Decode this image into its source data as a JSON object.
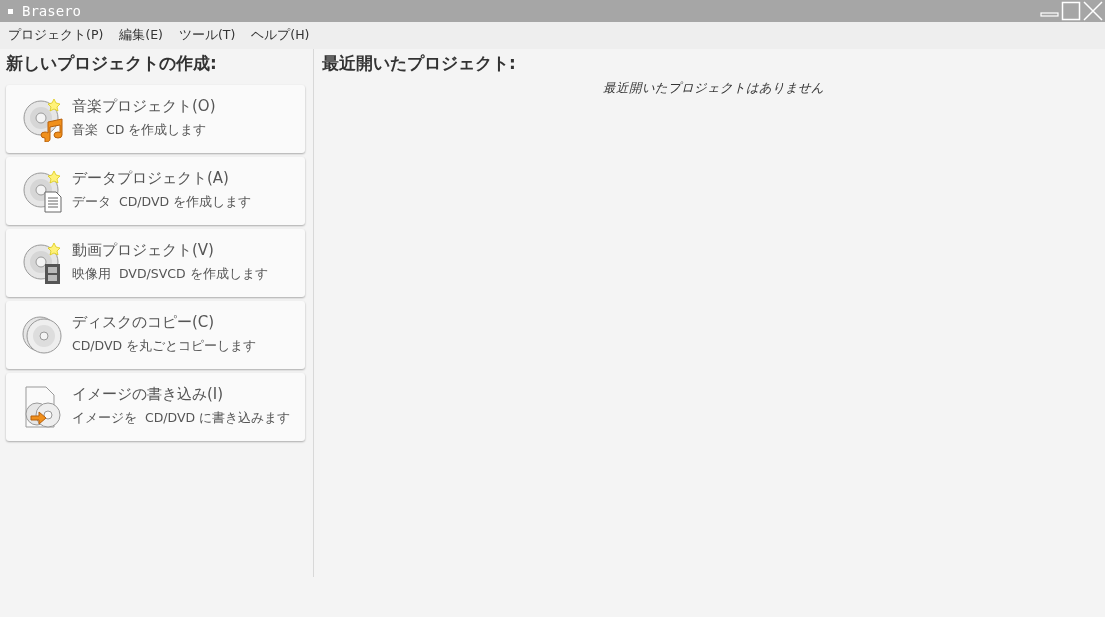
{
  "window": {
    "title": "Brasero"
  },
  "menu": [
    "プロジェクト(P)",
    "編集(E)",
    "ツール(T)",
    "ヘルプ(H)"
  ],
  "new_project": {
    "heading": "新しいプロジェクトの作成:",
    "items": [
      {
        "kind": "audio",
        "title": "音楽プロジェクト(O)",
        "subtitle": "音楽  CD を作成します"
      },
      {
        "kind": "data",
        "title": "データプロジェクト(A)",
        "subtitle": "データ  CD/DVD を作成します"
      },
      {
        "kind": "video",
        "title": "動画プロジェクト(V)",
        "subtitle": "映像用  DVD/SVCD を作成します"
      },
      {
        "kind": "copy",
        "title": "ディスクのコピー(C)",
        "subtitle": "CD/DVD を丸ごとコピーします"
      },
      {
        "kind": "image",
        "title": "イメージの書き込み(I)",
        "subtitle": "イメージを  CD/DVD に書き込みます"
      }
    ]
  },
  "recent": {
    "heading": "最近開いたプロジェクト:",
    "empty_message": "最近開いたプロジェクトはありません"
  }
}
